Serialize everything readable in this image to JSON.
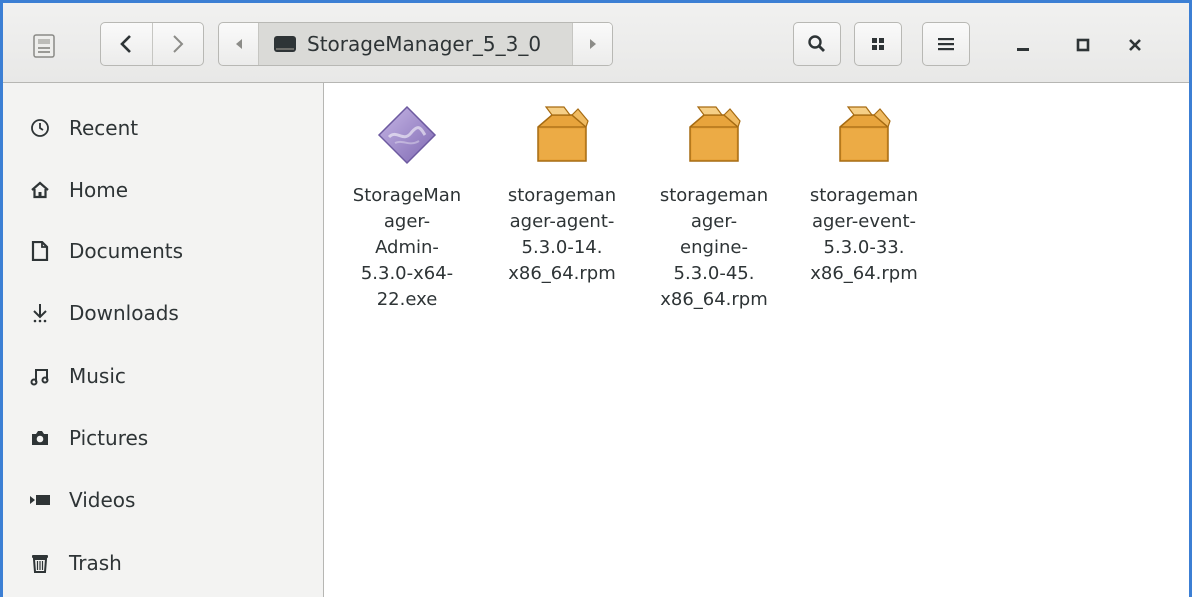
{
  "window": {
    "path_label": "StorageManager_5_3_0"
  },
  "sidebar": {
    "items": [
      {
        "label": "Recent",
        "icon": "clock-icon"
      },
      {
        "label": "Home",
        "icon": "home-icon"
      },
      {
        "label": "Documents",
        "icon": "document-icon"
      },
      {
        "label": "Downloads",
        "icon": "download-icon"
      },
      {
        "label": "Music",
        "icon": "music-icon"
      },
      {
        "label": "Pictures",
        "icon": "camera-icon"
      },
      {
        "label": "Videos",
        "icon": "video-icon"
      },
      {
        "label": "Trash",
        "icon": "trash-icon"
      }
    ]
  },
  "files": [
    {
      "lines": [
        "StorageMan",
        "ager-",
        "Admin-",
        "5.3.0-x64-",
        "22.exe"
      ],
      "icon": "exe-icon"
    },
    {
      "lines": [
        "storageman",
        "ager-agent-",
        "5.3.0-14.",
        "x86_64.rpm"
      ],
      "icon": "package-icon"
    },
    {
      "lines": [
        "storageman",
        "ager-",
        "engine-",
        "5.3.0-45.",
        "x86_64.rpm"
      ],
      "icon": "package-icon"
    },
    {
      "lines": [
        "storageman",
        "ager-event-",
        "5.3.0-33.",
        "x86_64.rpm"
      ],
      "icon": "package-icon"
    }
  ],
  "colors": {
    "accent": "#3c7fd4",
    "package": "#e8a43c"
  }
}
